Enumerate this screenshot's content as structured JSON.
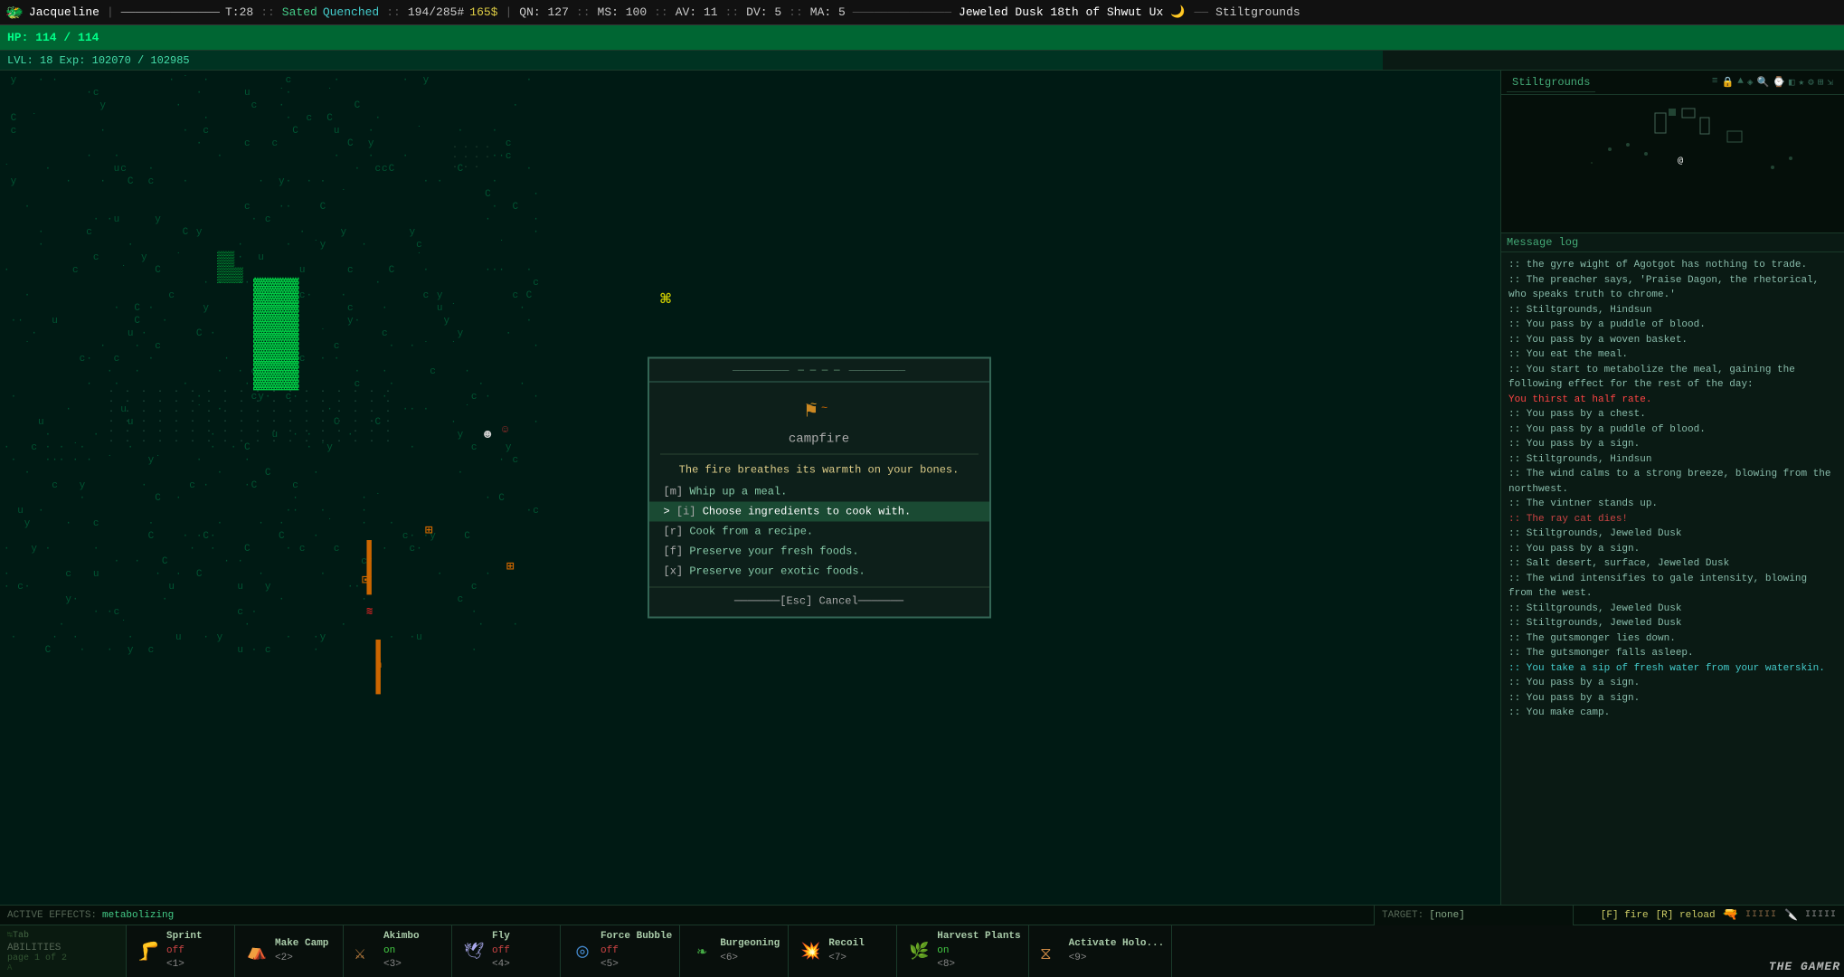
{
  "topbar": {
    "player_name": "Jacqueline",
    "turn": "T:28",
    "status1": "Sated",
    "status2": "Quenched",
    "nutrition": "194/285#",
    "money": "165$",
    "qn": "QN: 127",
    "ms": "MS: 100",
    "av": "AV: 11",
    "dv": "DV: 5",
    "ma": "MA: 5",
    "location": "Jeweled Dusk 18th of Shwut Ux",
    "zone": "Stiltgrounds"
  },
  "hp": {
    "current": 114,
    "max": 114,
    "display": "HP: 114 / 114",
    "fill_pct": 100
  },
  "lvl": {
    "level": 18,
    "exp": 102070,
    "exp_max": 102985,
    "display": "LVL: 18  Exp: 102070 / 102985"
  },
  "dialog": {
    "title": "campfire",
    "icon": "✦",
    "description": "The fire breathes its warmth on your bones.",
    "options": [
      {
        "key": "[m]",
        "text": "Whip up a meal."
      },
      {
        "key": "[i]",
        "text": "Choose ingredients to cook with.",
        "selected": true
      },
      {
        "key": "[r]",
        "text": "Cook from a recipe."
      },
      {
        "key": "[f]",
        "text": "Preserve your fresh foods."
      },
      {
        "key": "[x]",
        "text": "Preserve your exotic foods."
      }
    ],
    "cancel": "[Esc] Cancel"
  },
  "right_panel": {
    "minimap_title": "Stiltgrounds",
    "message_log_title": "Message log",
    "messages": [
      {
        "text": ":: the gyre wight of Agotgot has nothing to trade.",
        "class": "msg-normal"
      },
      {
        "text": ":: The preacher says, 'Praise Dagon, the rhetorical, who speaks truth to chrome.'",
        "class": "msg-normal"
      },
      {
        "text": ":: Stiltgrounds, Hindsun",
        "class": "msg-normal"
      },
      {
        "text": ":: You pass by a puddle of blood.",
        "class": "msg-normal"
      },
      {
        "text": ":: You pass by a woven basket.",
        "class": "msg-normal"
      },
      {
        "text": ":: You eat the meal.",
        "class": "msg-normal"
      },
      {
        "text": ":: You start to metabolize the meal, gaining the following effect for the rest of the day:",
        "class": "msg-normal"
      },
      {
        "text": "You thirst at half rate.",
        "class": "msg-thirst"
      },
      {
        "text": ":: You pass by a chest.",
        "class": "msg-normal"
      },
      {
        "text": ":: You pass by a puddle of blood.",
        "class": "msg-normal"
      },
      {
        "text": ":: You pass by a sign.",
        "class": "msg-normal"
      },
      {
        "text": ":: Stiltgrounds, Hindsun",
        "class": "msg-normal"
      },
      {
        "text": ":: The wind calms to a strong breeze, blowing from the northwest.",
        "class": "msg-normal"
      },
      {
        "text": ":: The vintner stands up.",
        "class": "msg-normal"
      },
      {
        "text": ":: The ray cat dies!",
        "class": "msg-red"
      },
      {
        "text": ":: Stiltgrounds, Jeweled Dusk",
        "class": "msg-normal"
      },
      {
        "text": ":: You pass by a sign.",
        "class": "msg-normal"
      },
      {
        "text": ":: Salt desert, surface, Jeweled Dusk",
        "class": "msg-normal"
      },
      {
        "text": ":: The wind intensifies to gale intensity, blowing from the west.",
        "class": "msg-normal"
      },
      {
        "text": ":: Stiltgrounds, Jeweled Dusk",
        "class": "msg-normal"
      },
      {
        "text": ":: Stiltgrounds, Jeweled Dusk",
        "class": "msg-normal"
      },
      {
        "text": ":: The gutsmonger lies down.",
        "class": "msg-normal"
      },
      {
        "text": ":: The gutsmonger falls asleep.",
        "class": "msg-normal"
      },
      {
        "text": ":: You take a sip of fresh water from your waterskin.",
        "class": "msg-highlight"
      },
      {
        "text": ":: You pass by a sign.",
        "class": "msg-normal"
      },
      {
        "text": ":: You pass by a sign.",
        "class": "msg-normal"
      },
      {
        "text": ":: You make camp.",
        "class": "msg-normal"
      }
    ]
  },
  "bottom_bar": {
    "active_effects_label": "ACTIVE EFFECTS:",
    "active_effects": "metabolizing",
    "targets_label": "TARGET:",
    "targets_value": "[none]",
    "fire_key": "[F] fire",
    "reload_key": "[R] reload",
    "ammo1": "IIIII",
    "ammo2": "IIIII",
    "abilities_label": "ABILITIES",
    "abilities_page": "page 1 of 2",
    "tab_hint": "Tab",
    "abilities": [
      {
        "name": "Sprint",
        "status": "off",
        "key": "<1>",
        "icon": "🦵",
        "status_class": "ability-status-off"
      },
      {
        "name": "Make Camp",
        "status": null,
        "key": "<2>",
        "icon": "⛺",
        "status_class": ""
      },
      {
        "name": "Akimbo",
        "status": "on",
        "key": "<3>",
        "icon": "🔫",
        "status_class": "ability-status-on"
      },
      {
        "name": "Fly",
        "status": "off",
        "key": "<4>",
        "icon": "🕊",
        "status_class": "ability-status-off"
      },
      {
        "name": "Force Bubble",
        "status": "off",
        "key": "<5>",
        "icon": "🔵",
        "status_class": "ability-status-off"
      },
      {
        "name": "Burgeoning",
        "status": null,
        "key": "<6>",
        "icon": "🌱",
        "status_class": ""
      },
      {
        "name": "Recoil",
        "status": null,
        "key": "<7>",
        "icon": "💥",
        "status_class": ""
      },
      {
        "name": "Harvest Plants",
        "status": "on",
        "key": "<8>",
        "icon": "🌿",
        "status_class": "ability-status-on"
      },
      {
        "name": "Activate Holo...",
        "status": null,
        "key": "<9>",
        "icon": "📡",
        "status_class": ""
      }
    ]
  }
}
